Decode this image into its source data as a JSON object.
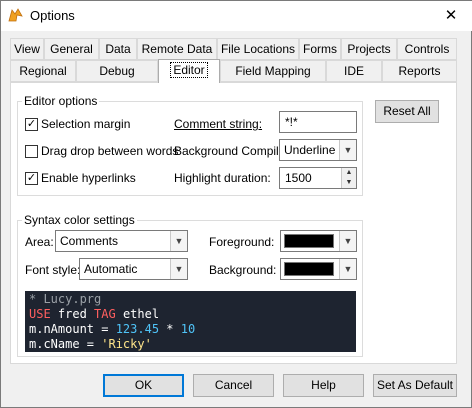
{
  "window": {
    "title": "Options",
    "close_glyph": "✕"
  },
  "tabs_back": [
    {
      "label": "View"
    },
    {
      "label": "General"
    },
    {
      "label": "Data"
    },
    {
      "label": "Remote Data"
    },
    {
      "label": "File Locations"
    },
    {
      "label": "Forms"
    },
    {
      "label": "Projects"
    },
    {
      "label": "Controls"
    }
  ],
  "tabs_front": [
    {
      "label": "Regional"
    },
    {
      "label": "Debug"
    },
    {
      "label": "Editor",
      "selected": true
    },
    {
      "label": "Field Mapping"
    },
    {
      "label": "IDE"
    },
    {
      "label": "Reports"
    }
  ],
  "editor_options": {
    "group_label": "Editor options",
    "selection_margin": {
      "label": "Selection margin",
      "checked": true
    },
    "drag_drop": {
      "label": "Drag drop between words",
      "checked": false
    },
    "enable_hyperlinks": {
      "label": "Enable hyperlinks",
      "checked": true
    },
    "comment_string": {
      "label": "Comment string:",
      "value": "*!*"
    },
    "background_compile": {
      "label": "Background Compile:",
      "value": "Underline"
    },
    "highlight_duration": {
      "label": "Highlight duration:",
      "value": "1500"
    }
  },
  "reset_all": {
    "label": "Reset All"
  },
  "syntax": {
    "group_label": "Syntax color settings",
    "area": {
      "label": "Area:",
      "value": "Comments"
    },
    "font_style": {
      "label": "Font style:",
      "value": "Automatic"
    },
    "foreground": {
      "label": "Foreground:",
      "color": "#000000"
    },
    "background": {
      "label": "Background:",
      "color": "#000000"
    }
  },
  "preview": {
    "line1": "* Lucy.prg",
    "line2_kw": "USE",
    "line2_a": " fred ",
    "line2_kw2": "TAG",
    "line2_b": " ethel",
    "line3_a": "m.nAmount = ",
    "line3_num": "123.45",
    "line3_op": " * ",
    "line3_num2": "10",
    "line4_a": "m.cName = ",
    "line4_str": "'Ricky'",
    "colors": {
      "bg": "#1e2430",
      "comment": "#9aa0a6",
      "keyword": "#ff5f5f",
      "text": "#ffffff",
      "number": "#4fc3f7",
      "string": "#ffe58a"
    }
  },
  "buttons": {
    "ok": "OK",
    "cancel": "Cancel",
    "help": "Help",
    "set_default": "Set As Default"
  }
}
